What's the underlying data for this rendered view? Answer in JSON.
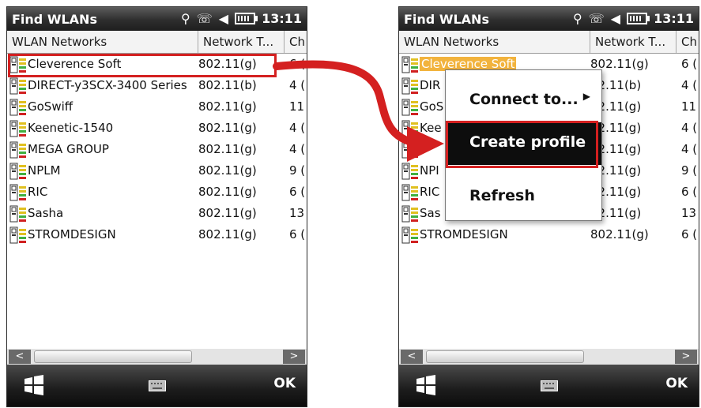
{
  "title": "Find WLANs",
  "status": {
    "time": "13:11",
    "signal_icon": "connectivity-icon",
    "volume_icon": "speaker-muted-icon",
    "battery_icon": "battery-icon"
  },
  "columns": {
    "name": "WLAN Networks",
    "type": "Network T...",
    "channel": "Ch"
  },
  "networks": [
    {
      "name": "Cleverence Soft",
      "type": "802.11(g)",
      "channel": "6 ("
    },
    {
      "name": "DIRECT-y3SCX-3400 Series",
      "type": "802.11(b)",
      "channel": "4 ("
    },
    {
      "name": "GoSwiff",
      "type": "802.11(g)",
      "channel": "11"
    },
    {
      "name": "Keenetic-1540",
      "type": "802.11(g)",
      "channel": "4 ("
    },
    {
      "name": "MEGA GROUP",
      "type": "802.11(g)",
      "channel": "4 ("
    },
    {
      "name": "NPLM",
      "type": "802.11(g)",
      "channel": "9 ("
    },
    {
      "name": "RIC",
      "type": "802.11(g)",
      "channel": "6 ("
    },
    {
      "name": "Sasha",
      "type": "802.11(g)",
      "channel": "13"
    },
    {
      "name": "STROMDESIGN",
      "type": "802.11(g)",
      "channel": "6 ("
    }
  ],
  "right_networks": [
    {
      "name": "Cleverence Soft",
      "type": "802.11(g)",
      "channel": "6 ("
    },
    {
      "name": "DIR",
      "type": "02.11(b)",
      "channel": "4 ("
    },
    {
      "name": "GoS",
      "type": "02.11(g)",
      "channel": "11"
    },
    {
      "name": "Kee",
      "type": "02.11(g)",
      "channel": "4 ("
    },
    {
      "name": "",
      "type": "02.11(g)",
      "channel": "4 ("
    },
    {
      "name": "NPI",
      "type": "02.11(g)",
      "channel": "9 ("
    },
    {
      "name": "RIC",
      "type": "02.11(g)",
      "channel": "6 ("
    },
    {
      "name": "Sas",
      "type": "02.11(g)",
      "channel": "13"
    },
    {
      "name": "STROMDESIGN",
      "type": "802.11(g)",
      "channel": "6 ("
    }
  ],
  "context_menu": {
    "connect": "Connect to...",
    "create": "Create profile",
    "refresh": "Refresh"
  },
  "softkeys": {
    "ok": "OK"
  },
  "colors": {
    "highlight": "#d42020",
    "selection": "#f2b33d"
  }
}
